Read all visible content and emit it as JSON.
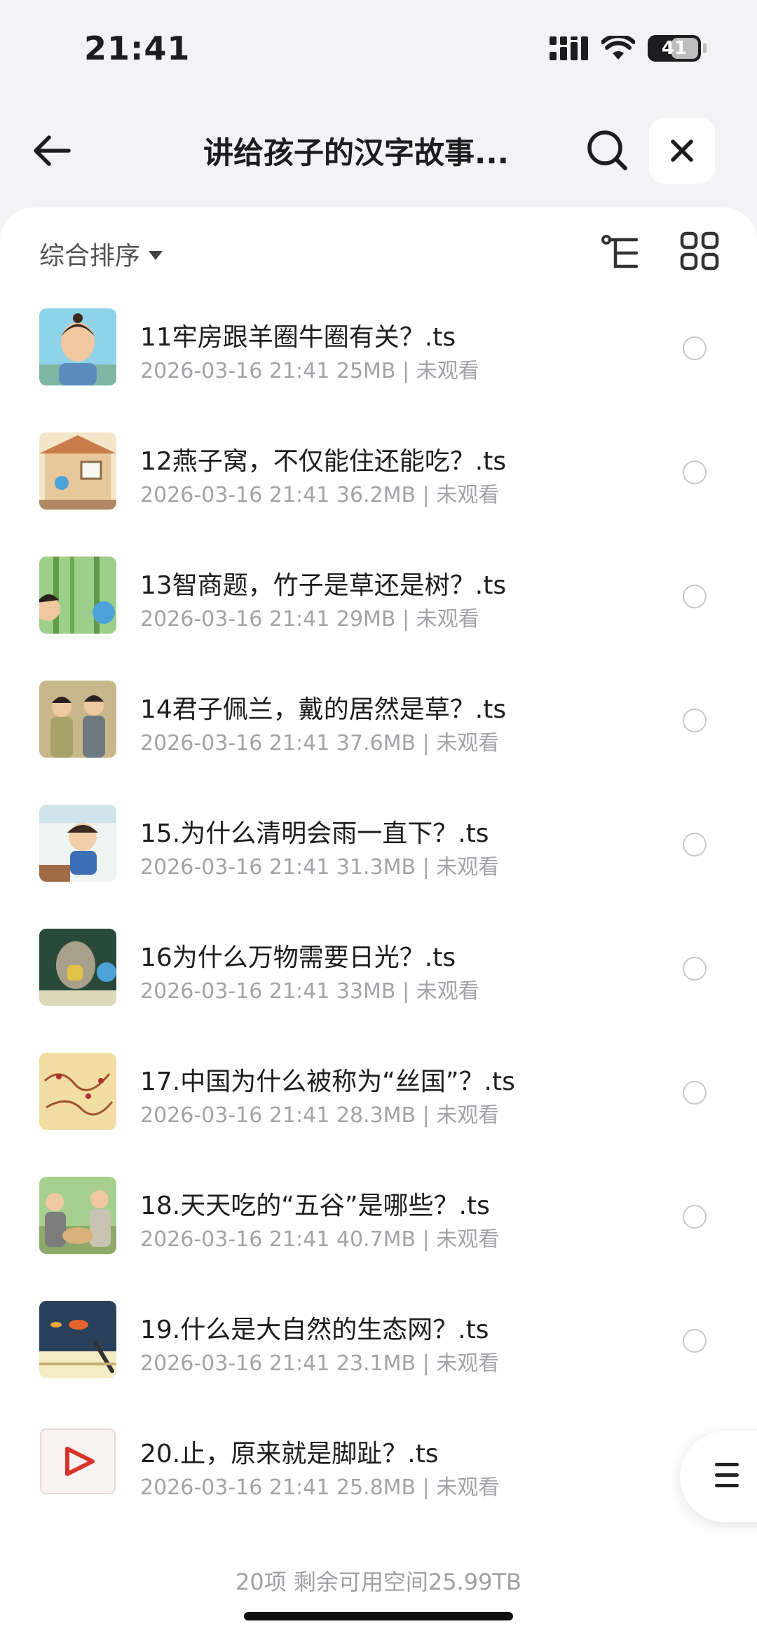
{
  "status_bar": {
    "time": "21:41",
    "battery": "41"
  },
  "header": {
    "title": "讲给孩子的汉字故事..."
  },
  "toolbar": {
    "sort_label": "综合排序"
  },
  "files": [
    {
      "name": "11牢房跟羊圈牛圈有关？.ts",
      "meta": "2026-03-16 21:41  25MB | 未观看",
      "thumb": "scene-man"
    },
    {
      "name": "12燕子窝，不仅能住还能吃？.ts",
      "meta": "2026-03-16 21:41  36.2MB | 未观看",
      "thumb": "scene-house"
    },
    {
      "name": "13智商题，竹子是草还是树？.ts",
      "meta": "2026-03-16 21:41  29MB | 未观看",
      "thumb": "scene-bamboo"
    },
    {
      "name": "14君子佩兰，戴的居然是草？.ts",
      "meta": "2026-03-16 21:41  37.6MB | 未观看",
      "thumb": "scene-gentlemen"
    },
    {
      "name": "15.为什么清明会雨一直下？.ts",
      "meta": "2026-03-16 21:41  31.3MB | 未观看",
      "thumb": "scene-boy"
    },
    {
      "name": "16为什么万物需要日光？.ts",
      "meta": "2026-03-16 21:41  33MB | 未观看",
      "thumb": "scene-stone"
    },
    {
      "name": "17.中国为什么被称为“丝国”？.ts",
      "meta": "2026-03-16 21:41  28.3MB | 未观看",
      "thumb": "scene-map"
    },
    {
      "name": "18.天天吃的“五谷”是哪些？.ts",
      "meta": "2026-03-16 21:41  40.7MB | 未观看",
      "thumb": "scene-farmers"
    },
    {
      "name": "19.什么是大自然的生态网？.ts",
      "meta": "2026-03-16 21:41  23.1MB | 未观看",
      "thumb": "scene-blackboard"
    },
    {
      "name": "20.止，原来就是脚趾？.ts",
      "meta": "2026-03-16 21:41  25.8MB | 未观看",
      "thumb": "video-file-icon"
    }
  ],
  "footer": {
    "summary": "20项 剩余可用空间25.99TB"
  }
}
